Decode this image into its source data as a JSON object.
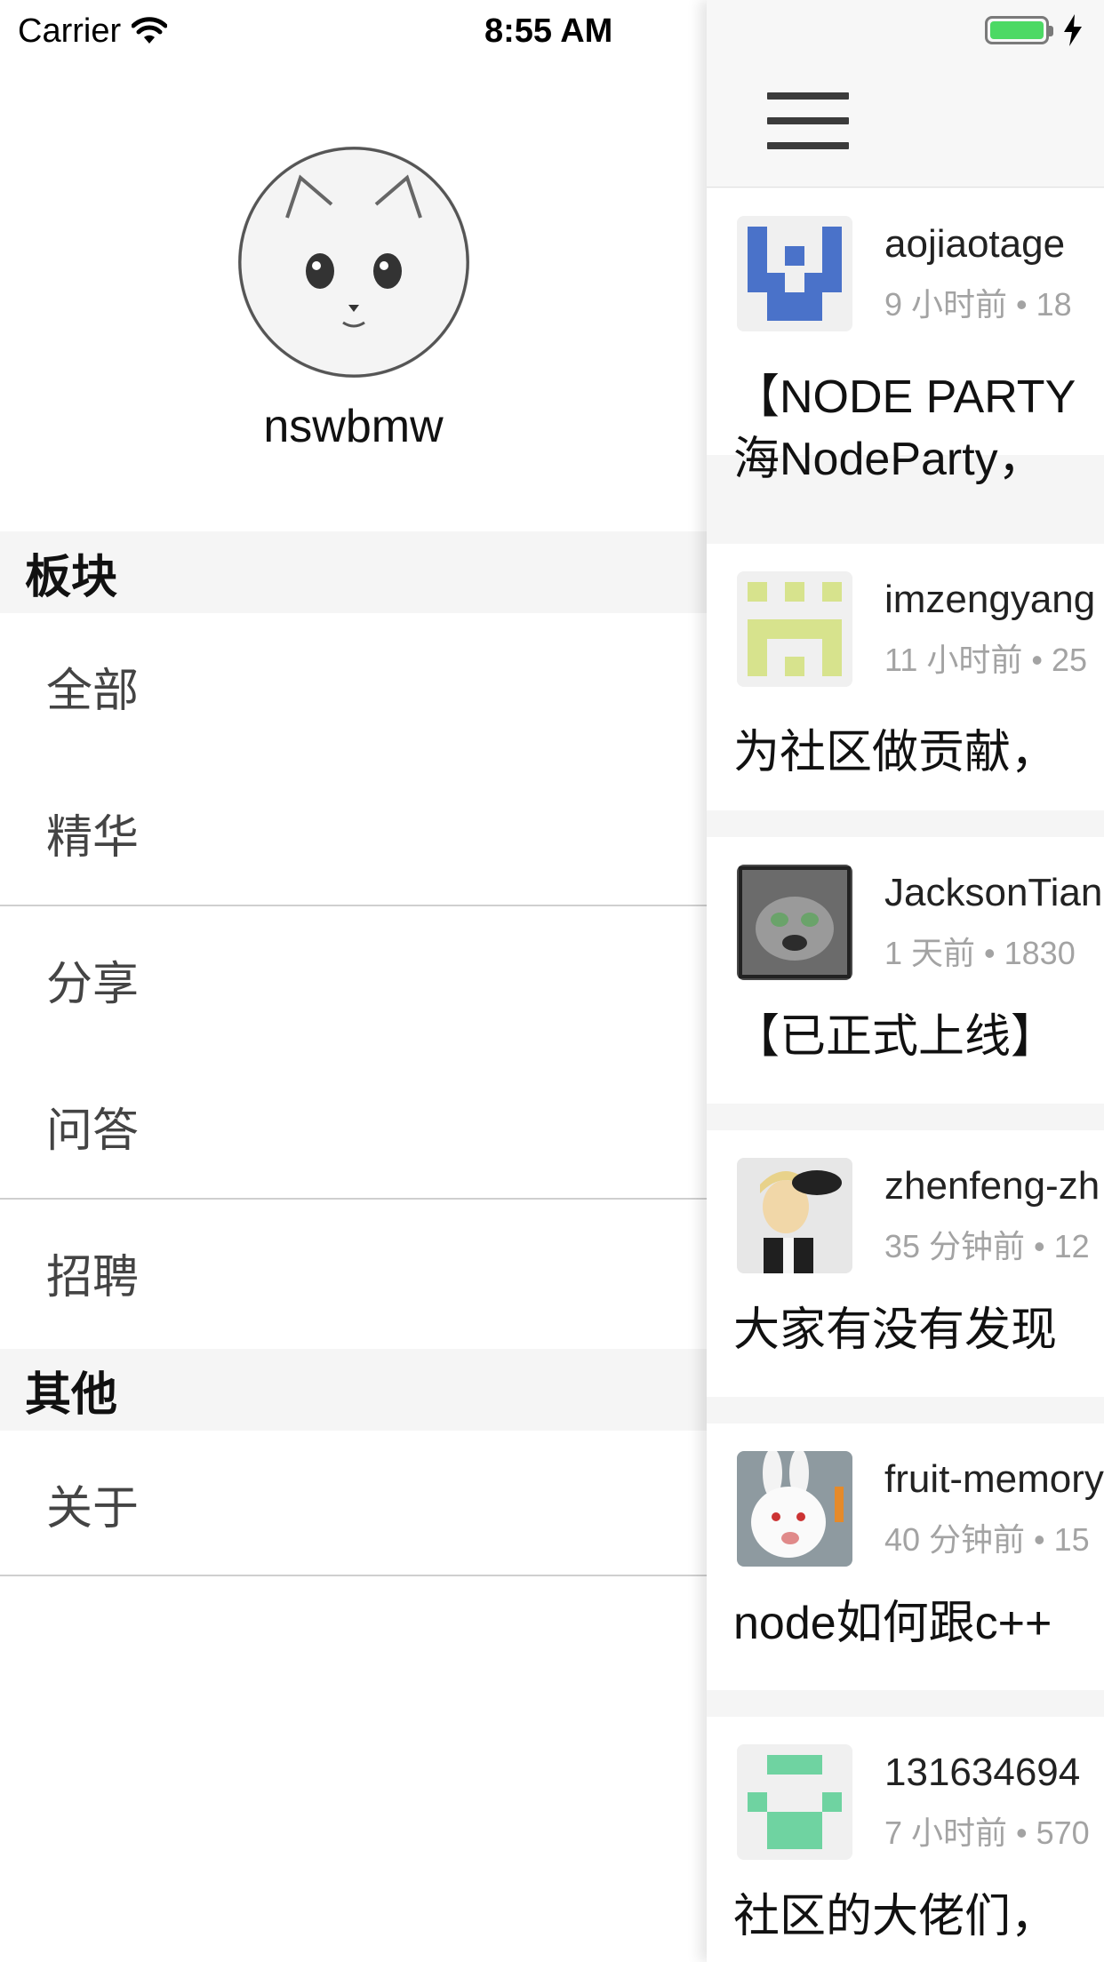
{
  "status": {
    "carrier": "Carrier",
    "time": "8:55 AM"
  },
  "drawer": {
    "username": "nswbmw",
    "sections": [
      {
        "header": "板块",
        "items": [
          "全部",
          "精华",
          "分享",
          "问答",
          "招聘"
        ]
      },
      {
        "header": "其他",
        "items": [
          "关于"
        ]
      }
    ]
  },
  "feed": {
    "posts": [
      {
        "author": "aojiaotage",
        "meta": "9 小时前 • 18",
        "title": "【NODE PARTY",
        "title2": "海NodeParty，",
        "avatar": "identicon-blue"
      },
      {
        "author": "imzengyang",
        "meta": "11 小时前 • 25",
        "title": "为社区做贡献，",
        "avatar": "identicon-lime"
      },
      {
        "author": "JacksonTian",
        "meta": "1 天前 • 1830",
        "title": "【已正式上线】",
        "avatar": "raccoon-photo"
      },
      {
        "author": "zhenfeng-zh",
        "meta": "35 分钟前 • 12",
        "title": "大家有没有发现",
        "avatar": "anime-photo"
      },
      {
        "author": "fruit-memory",
        "meta": "40 分钟前 • 15",
        "title": "node如何跟c++",
        "avatar": "rabbit-photo"
      },
      {
        "author": "131634694",
        "meta": "7 小时前 • 570",
        "title": "社区的大佬们，",
        "avatar": "identicon-green"
      }
    ]
  },
  "colors": {
    "battery": "#4cd964",
    "identicon_blue": "#4a72c9",
    "identicon_lime": "#d7e38d",
    "identicon_green": "#6fd3a1"
  }
}
